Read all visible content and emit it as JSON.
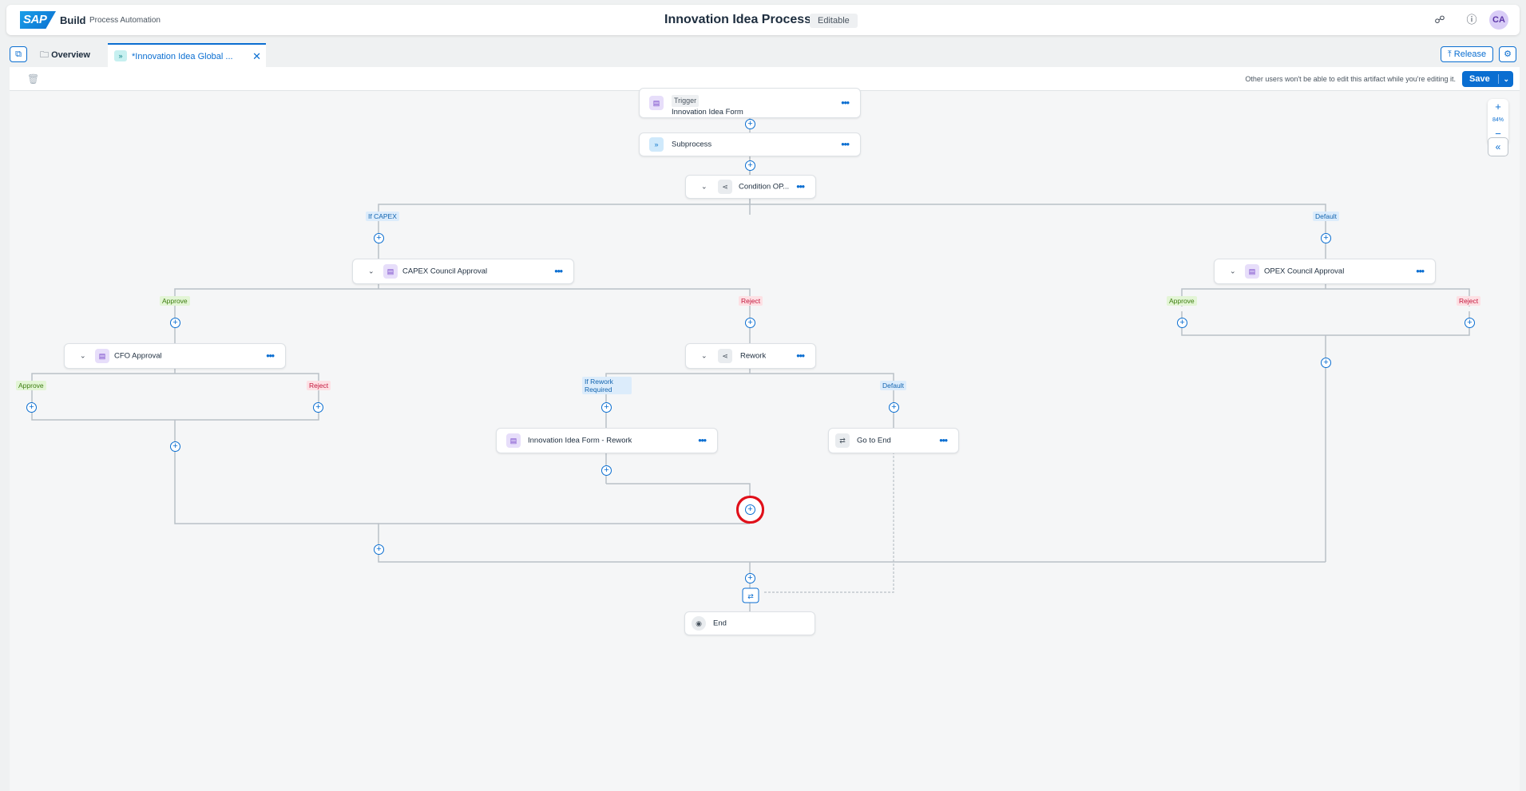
{
  "shell": {
    "logo": "SAP",
    "build": "Build",
    "product": "Process Automation",
    "title": "Innovation Idea Process",
    "status": "Editable",
    "avatar": "CA"
  },
  "tabs": {
    "overview": "Overview",
    "active": "*Innovation Idea Global ...",
    "release": "Release"
  },
  "toolbar": {
    "note": "Other users won't be able to edit this artifact while you're editing it.",
    "save": "Save"
  },
  "zoom": {
    "level": "84%"
  },
  "nodes": {
    "trigger_badge": "Trigger",
    "trigger": "Innovation Idea Form",
    "subprocess": "Subprocess",
    "condition": "Condition OP...",
    "capex": "CAPEX Council Approval",
    "opex": "OPEX Council Approval",
    "cfo": "CFO Approval",
    "rework": "Rework",
    "rework_form": "Innovation Idea Form - Rework",
    "goto_end": "Go to End",
    "end": "End"
  },
  "tags": {
    "if_capex": "If CAPEX",
    "default1": "Default",
    "approve1": "Approve",
    "reject1": "Reject",
    "approve2": "Approve",
    "reject2": "Reject",
    "approve3": "Approve",
    "reject3": "Reject",
    "if_rework": "If Rework Required",
    "default2": "Default"
  },
  "colors": {
    "accent": "#0a6ed1",
    "highlight": "#e0101a"
  }
}
